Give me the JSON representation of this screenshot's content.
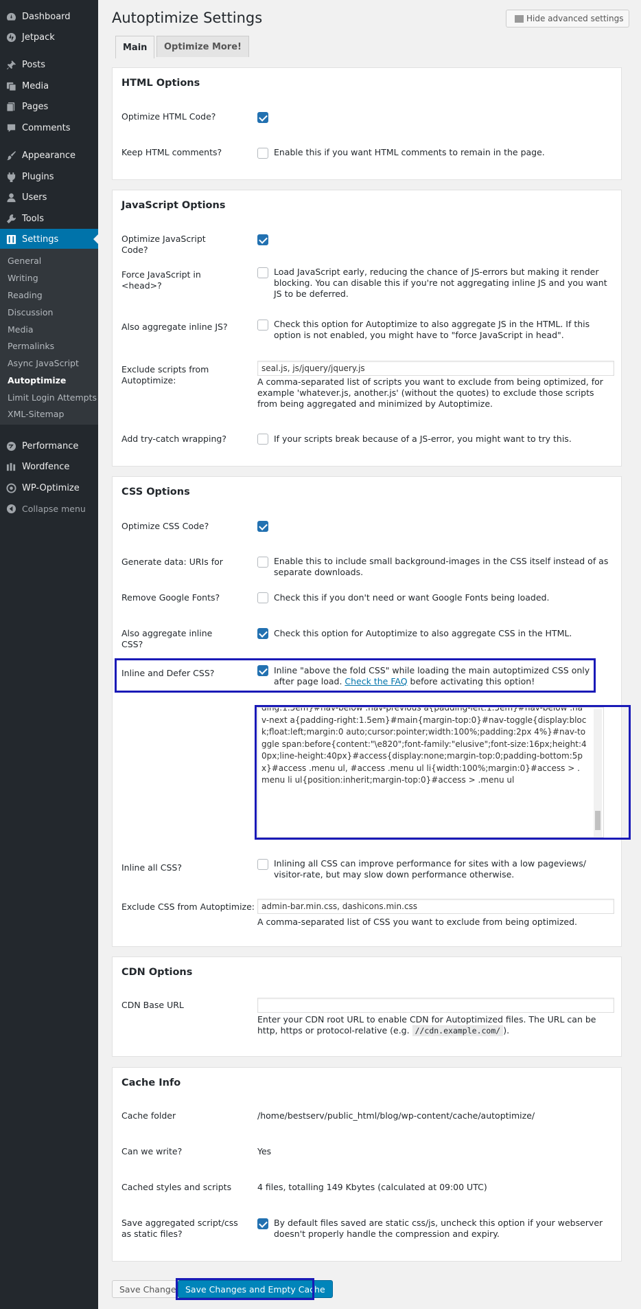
{
  "sidebar": {
    "menu": [
      {
        "label": "Dashboard",
        "icon": "dashboard-icon"
      },
      {
        "label": "Jetpack",
        "icon": "jetpack-icon"
      },
      {
        "label": "Posts",
        "icon": "pin-icon"
      },
      {
        "label": "Media",
        "icon": "media-icon"
      },
      {
        "label": "Pages",
        "icon": "pages-icon"
      },
      {
        "label": "Comments",
        "icon": "comment-icon"
      },
      {
        "label": "Appearance",
        "icon": "brush-icon"
      },
      {
        "label": "Plugins",
        "icon": "plugin-icon"
      },
      {
        "label": "Users",
        "icon": "user-icon"
      },
      {
        "label": "Tools",
        "icon": "wrench-icon"
      },
      {
        "label": "Settings",
        "icon": "settings-icon"
      }
    ],
    "submenu": [
      "General",
      "Writing",
      "Reading",
      "Discussion",
      "Media",
      "Permalinks",
      "Async JavaScript",
      "Autoptimize",
      "Limit Login Attempts",
      "XML-Sitemap"
    ],
    "menu_bottom": [
      {
        "label": "Performance",
        "icon": "performance-icon"
      },
      {
        "label": "Wordfence",
        "icon": "wordfence-icon"
      },
      {
        "label": "WP-Optimize",
        "icon": "wp-optimize-icon"
      }
    ],
    "collapse_label": "Collapse menu",
    "accent_color": "#0073aa"
  },
  "header": {
    "title": "Autoptimize Settings",
    "advanced_toggle": "Hide advanced settings",
    "tabs": [
      "Main",
      "Optimize More!"
    ]
  },
  "html_options": {
    "title": "HTML Options",
    "optimize_label": "Optimize HTML Code?",
    "keep_comments_label": "Keep HTML comments?",
    "keep_comments_desc": "Enable this if you want HTML comments to remain in the page."
  },
  "js_options": {
    "title": "JavaScript Options",
    "optimize_label": "Optimize JavaScript Code?",
    "force_head_label": "Force JavaScript in <head>?",
    "force_head_desc": "Load JavaScript early, reducing the chance of JS-errors but making it render blocking. You can disable this if you're not aggregating inline JS and you want JS to be deferred.",
    "aggregate_inline_label": "Also aggregate inline JS?",
    "aggregate_inline_desc": "Check this option for Autoptimize to also aggregate JS in the HTML. If this option is not enabled, you might have to \"force JavaScript in head\".",
    "exclude_label": "Exclude scripts from Autoptimize:",
    "exclude_value": "seal.js, js/jquery/jquery.js",
    "exclude_desc": "A comma-separated list of scripts you want to exclude from being optimized, for example 'whatever.js, another.js' (without the quotes) to exclude those scripts from being aggregated and minimized by Autoptimize.",
    "trycatch_label": "Add try-catch wrapping?",
    "trycatch_desc": "If your scripts break because of a JS-error, you might want to try this."
  },
  "css_options": {
    "title": "CSS Options",
    "optimize_label": "Optimize CSS Code?",
    "datauri_label": "Generate data: URIs for images?",
    "datauri_desc": "Enable this to include small background-images in the CSS itself instead of as separate downloads.",
    "google_fonts_label": "Remove Google Fonts?",
    "google_fonts_desc": "Check this if you don't need or want Google Fonts being loaded.",
    "aggregate_inline_label": "Also aggregate inline CSS?",
    "aggregate_inline_desc": "Check this option for Autoptimize to also aggregate CSS in the HTML.",
    "defer_label": "Inline and Defer CSS?",
    "defer_desc_a": "Inline \"above the fold CSS\" while loading the main autoptimized CSS only after page load. ",
    "defer_link": "Check the FAQ",
    "defer_desc_b": " before activating this option!",
    "critical_css": "ding:1.5em}#nav-below .nav-previous a{padding-left:1.5em}#nav-below .nav-next a{padding-right:1.5em}#main{margin-top:0}#nav-toggle{display:block;float:left;margin:0 auto;cursor:pointer;width:100%;padding:2px 4%}#nav-toggle span:before{content:\"\\e820\";font-family:\"elusive\";font-size:16px;height:40px;line-height:40px}#access{display:none;margin-top:0;padding-bottom:5px}#access .menu ul, #access .menu ul li{width:100%;margin:0}#access > .menu li ul{position:inherit;margin-top:0}#access > .menu ul",
    "inline_all_label": "Inline all CSS?",
    "inline_all_desc": "Inlining all CSS can improve performance for sites with a low pageviews/ visitor-rate, but may slow down performance otherwise.",
    "exclude_label": "Exclude CSS from Autoptimize:",
    "exclude_value": "admin-bar.min.css, dashicons.min.css",
    "exclude_desc": "A comma-separated list of CSS you want to exclude from being optimized."
  },
  "cdn_options": {
    "title": "CDN Options",
    "base_label": "CDN Base URL",
    "base_value": "",
    "desc_a": "Enter your CDN root URL to enable CDN for Autoptimized files. The URL can be http, https or protocol-relative (e.g. ",
    "desc_code": "//cdn.example.com/",
    "desc_b": ")."
  },
  "cache_info": {
    "title": "Cache Info",
    "folder_label": "Cache folder",
    "folder_value": "/home/bestserv/public_html/blog/wp-content/cache/autoptimize/",
    "write_label": "Can we write?",
    "write_value": "Yes",
    "cached_label": "Cached styles and scripts",
    "cached_value": "4 files, totalling 149 Kbytes (calculated at 09:00 UTC)",
    "static_label": "Save aggregated script/css as static files?",
    "static_desc": "By default files saved are static css/js, uncheck this option if your webserver doesn't properly handle the compression and expiry."
  },
  "buttons": {
    "save": "Save Changes",
    "save_empty": "Save Changes and Empty Cache"
  },
  "checkboxes": {
    "html_optimize": true,
    "html_keep_comments": false,
    "js_optimize": true,
    "js_force_head": false,
    "js_aggregate_inline": false,
    "js_trycatch": false,
    "css_optimize": true,
    "css_datauri": false,
    "css_google_fonts": false,
    "css_aggregate_inline": true,
    "css_defer": true,
    "css_inline_all": false,
    "cache_static": true
  },
  "colors": {
    "highlight": "#1a1ab7",
    "primary_button": "#0085ba",
    "checkbox": "#2271b1"
  }
}
